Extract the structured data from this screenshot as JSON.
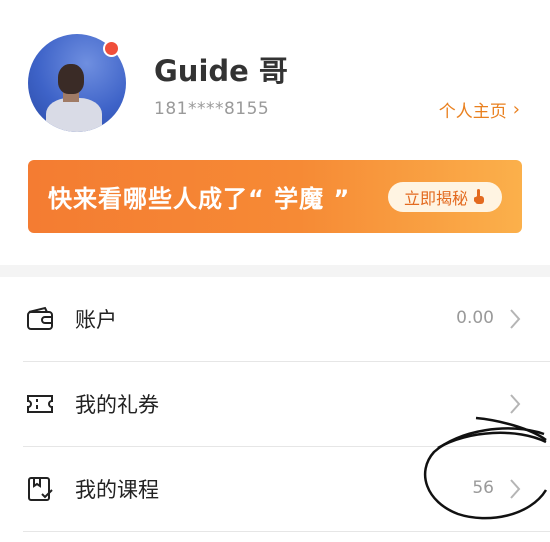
{
  "profile": {
    "username": "Guide 哥",
    "phone": "181****8155",
    "homepage_label": "个人主页",
    "homepage_chevron": "›"
  },
  "banner": {
    "text": "快来看哪些人成了“ 学魔 ”",
    "button_label": "立即揭秘"
  },
  "menu": {
    "items": [
      {
        "label": "账户",
        "value": "0.00",
        "icon": "wallet-icon"
      },
      {
        "label": "我的礼券",
        "value": "",
        "icon": "ticket-icon"
      },
      {
        "label": "我的课程",
        "value": "56",
        "icon": "course-book-icon"
      }
    ]
  },
  "colors": {
    "accent": "#e9801f",
    "banner_start": "#f47c32",
    "banner_end": "#fbb04b",
    "badge": "#f04e3a"
  }
}
